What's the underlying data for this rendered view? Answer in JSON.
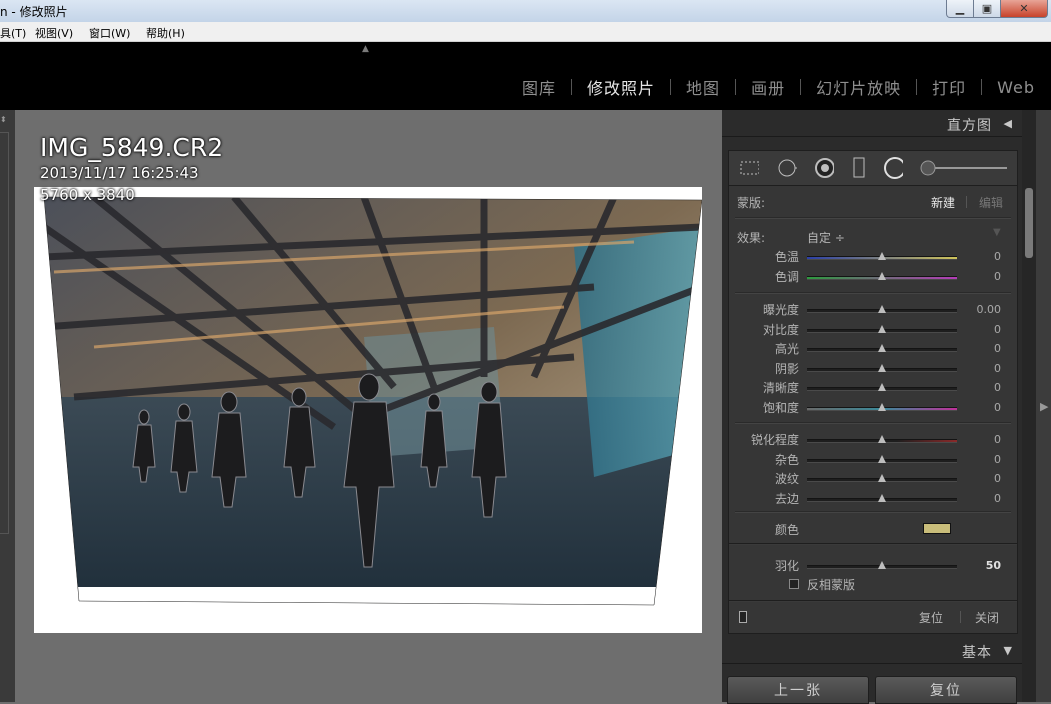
{
  "window": {
    "title": "n - 修改照片",
    "min_glyph": "▁",
    "max_glyph": "▣",
    "close_glyph": "✕"
  },
  "menu": [
    "具(T)",
    "视图(V)",
    "窗口(W)",
    "帮助(H)"
  ],
  "modules": {
    "items": [
      "图库",
      "修改照片",
      "地图",
      "画册",
      "幻灯片放映",
      "打印",
      "Web"
    ],
    "active": "修改照片"
  },
  "photo_info": {
    "filename": "IMG_5849.CR2",
    "datetime": "2013/11/17 16:25:43",
    "dimensions": "5760 x 3840"
  },
  "right_panel": {
    "histogram_label": "直方图",
    "mask": {
      "label": "蒙版:",
      "new": "新建",
      "edit": "编辑"
    },
    "effect": {
      "label": "效果:",
      "value": "自定 ÷"
    },
    "groups": [
      [
        {
          "label": "色温",
          "value": "0",
          "pos": 0.5,
          "track": "temp"
        },
        {
          "label": "色调",
          "value": "0",
          "pos": 0.5,
          "track": "tint"
        }
      ],
      [
        {
          "label": "曝光度",
          "value": "0.00",
          "pos": 0.5,
          "track": "plain"
        },
        {
          "label": "对比度",
          "value": "0",
          "pos": 0.5,
          "track": "plain"
        },
        {
          "label": "高光",
          "value": "0",
          "pos": 0.5,
          "track": "plain"
        },
        {
          "label": "阴影",
          "value": "0",
          "pos": 0.5,
          "track": "plain"
        },
        {
          "label": "清晰度",
          "value": "0",
          "pos": 0.5,
          "track": "plain"
        },
        {
          "label": "饱和度",
          "value": "0",
          "pos": 0.5,
          "track": "sat"
        }
      ],
      [
        {
          "label": "锐化程度",
          "value": "0",
          "pos": 0.5,
          "track": "sharp"
        },
        {
          "label": "杂色",
          "value": "0",
          "pos": 0.5,
          "track": "plain"
        },
        {
          "label": "波纹",
          "value": "0",
          "pos": 0.5,
          "track": "plain"
        },
        {
          "label": "去边",
          "value": "0",
          "pos": 0.5,
          "track": "plain"
        }
      ]
    ],
    "color_label": "颜色",
    "color_swatch": "#c9bd7a",
    "feather": {
      "label": "羽化",
      "value": "50",
      "pos": 0.5
    },
    "invert_label": "反相蒙版",
    "reset": "复位",
    "close": "关闭",
    "basic_label": "基本",
    "prev_button": "上一张",
    "reset_button": "复位"
  }
}
